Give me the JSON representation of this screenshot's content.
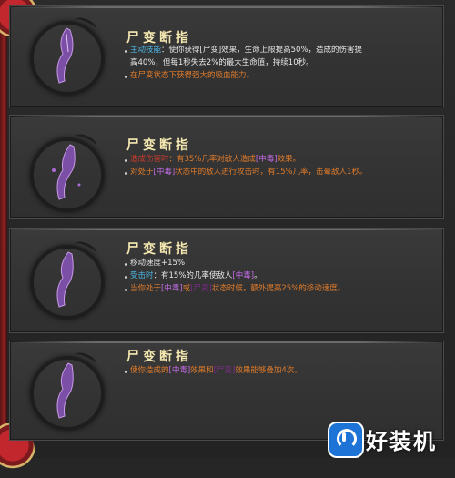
{
  "cards": [
    {
      "title": "尸变断指",
      "lines": [
        {
          "segments": [
            [
              "主动技能",
              "cy"
            ],
            [
              "：使你获得[尸变]效果，生命上限提高50%，造成的伤害提",
              "w"
            ]
          ],
          "bullet": true
        },
        {
          "segments": [
            [
              "高40%，但每1秒失去2%的最大生命值，持续10秒。",
              "w"
            ]
          ],
          "bullet": false
        },
        {
          "segments": [
            [
              "在尸变状态下获得强大的吸血能力。",
              "or"
            ]
          ],
          "bullet": true
        }
      ]
    },
    {
      "title": "尸变断指",
      "lines": [
        {
          "segments": [
            [
              "造成伤害时",
              "rd"
            ],
            [
              "：有35%几率对敌人造成",
              "or"
            ],
            [
              "[中毒]",
              "pu"
            ],
            [
              "效果。",
              "or"
            ]
          ],
          "bullet": true
        },
        {
          "segments": [
            [
              "对处于",
              "or"
            ],
            [
              "[中毒]",
              "pu"
            ],
            [
              "状态中的敌人进行攻击时，有15%几率，击晕敌人1秒。",
              "or"
            ]
          ],
          "bullet": true
        }
      ]
    },
    {
      "title": "尸变断指",
      "lines": [
        {
          "segments": [
            [
              "移动速度+15%",
              "w"
            ]
          ],
          "bullet": true
        },
        {
          "segments": [
            [
              "受击时",
              "cy"
            ],
            [
              "：有15%的几率使敌人",
              "w"
            ],
            [
              "[中毒]",
              "pu"
            ],
            [
              "。",
              "w"
            ]
          ],
          "bullet": true
        },
        {
          "segments": [
            [
              "当你处于",
              "or"
            ],
            [
              "[中毒]",
              "pu"
            ],
            [
              "或",
              "or"
            ],
            [
              "[尸变]",
              "dk"
            ],
            [
              "状态时候，额外提高25%的移动速度。",
              "or"
            ]
          ],
          "bullet": true
        }
      ]
    },
    {
      "title": "尸变断指",
      "lines": [
        {
          "segments": [
            [
              "使你造成的",
              "or"
            ],
            [
              "[中毒]",
              "pu"
            ],
            [
              "效果和",
              "or"
            ],
            [
              "[尸变]",
              "dk"
            ],
            [
              "效果能够叠加4次。",
              "or"
            ]
          ],
          "bullet": true
        }
      ]
    }
  ],
  "watermark": {
    "text": "好装机",
    "icon": "power-logo-icon",
    "color": "#1e74d6"
  },
  "colors": {
    "w": "#e6e6e6",
    "cy": "#4ab7e6",
    "or": "#e07b2a",
    "pu": "#c46be8",
    "rd": "#d23b2c",
    "dk": "#7d2a8a",
    "title": "#f4e7b0"
  }
}
